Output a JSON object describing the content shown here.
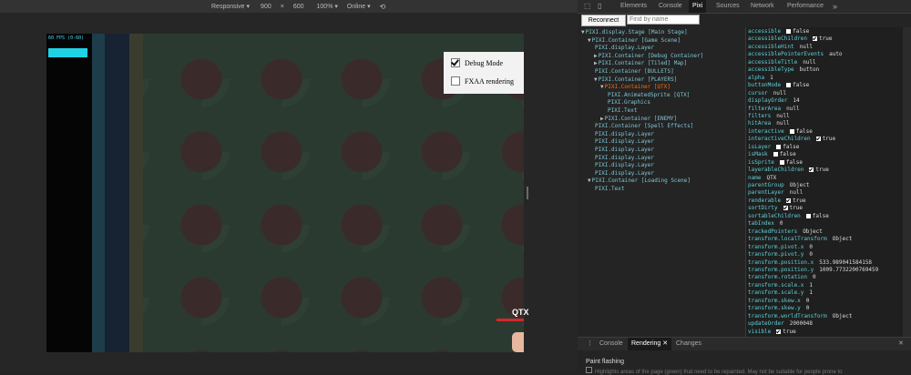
{
  "emulation": {
    "device": "Responsive ▾",
    "width": "900",
    "times": "×",
    "height": "600",
    "zoom": "100% ▾",
    "network": "Online ▾"
  },
  "game": {
    "fps_label": "60 FPS (0-60)",
    "options": [
      {
        "label": "Debug Mode",
        "checked": true
      },
      {
        "label": "FXAA rendering",
        "checked": false
      }
    ],
    "player_label": "QTX"
  },
  "devtools": {
    "tabs": [
      "Elements",
      "Console",
      "Pixi",
      "Sources",
      "Network",
      "Performance"
    ],
    "active_tab": "Pixi",
    "more": "»",
    "close": "✕"
  },
  "pixi": {
    "reconnect_label": "Reconnect",
    "find_placeholder": "Find by name",
    "tree": [
      {
        "label": "PIXI.display.Stage [Main Stage]",
        "indent": 0,
        "twisty": "▼"
      },
      {
        "label": "PIXI.Container [Game Scene]",
        "indent": 1,
        "twisty": "▼"
      },
      {
        "label": "PIXI.display.Layer",
        "indent": 2,
        "twisty": ""
      },
      {
        "label": "PIXI.Container [Debug Container]",
        "indent": 2,
        "twisty": "▶"
      },
      {
        "label": "PIXI.Container [Tiled] Map]",
        "indent": 2,
        "twisty": "▶"
      },
      {
        "label": "PIXI.Container [BULLETS]",
        "indent": 2,
        "twisty": ""
      },
      {
        "label": "PIXI.Container [PLAYERS]",
        "indent": 2,
        "twisty": "▼"
      },
      {
        "label": "PIXI.Container [QTX]",
        "indent": 3,
        "twisty": "▼",
        "selected": true
      },
      {
        "label": "PIXI.AnimatedSprite [QTX]",
        "indent": 4,
        "twisty": ""
      },
      {
        "label": "PIXI.Graphics",
        "indent": 4,
        "twisty": ""
      },
      {
        "label": "PIXI.Text",
        "indent": 4,
        "twisty": ""
      },
      {
        "label": "PIXI.Container [ENEMY]",
        "indent": 3,
        "twisty": "▶"
      },
      {
        "label": "PIXI.Container [Spell Effects]",
        "indent": 2,
        "twisty": ""
      },
      {
        "label": "PIXI.display.Layer",
        "indent": 2,
        "twisty": ""
      },
      {
        "label": "PIXI.display.Layer",
        "indent": 2,
        "twisty": ""
      },
      {
        "label": "PIXI.display.Layer",
        "indent": 2,
        "twisty": ""
      },
      {
        "label": "PIXI.display.Layer",
        "indent": 2,
        "twisty": ""
      },
      {
        "label": "PIXI.display.Layer",
        "indent": 2,
        "twisty": ""
      },
      {
        "label": "PIXI.display.Layer",
        "indent": 2,
        "twisty": ""
      },
      {
        "label": "PIXI.Container [Loading Scene]",
        "indent": 1,
        "twisty": "▼"
      },
      {
        "label": "PIXI.Text",
        "indent": 2,
        "twisty": ""
      }
    ],
    "properties": [
      {
        "key": "accessible",
        "checkbox": true,
        "checked": false,
        "value": "false"
      },
      {
        "key": "accessibleChildren",
        "checkbox": true,
        "checked": true,
        "value": "true"
      },
      {
        "key": "accessibleHint",
        "value": "null"
      },
      {
        "key": "accessiblePointerEvents",
        "value": "auto"
      },
      {
        "key": "accessibleTitle",
        "value": "null"
      },
      {
        "key": "accessibleType",
        "value": "button"
      },
      {
        "key": "alpha",
        "value": "1"
      },
      {
        "key": "buttonMode",
        "checkbox": true,
        "checked": false,
        "value": "false"
      },
      {
        "key": "cursor",
        "value": "null"
      },
      {
        "key": "displayOrder",
        "value": "14"
      },
      {
        "key": "filterArea",
        "value": "null"
      },
      {
        "key": "filters",
        "value": "null"
      },
      {
        "key": "hitArea",
        "value": "null"
      },
      {
        "key": "interactive",
        "checkbox": true,
        "checked": false,
        "value": "false"
      },
      {
        "key": "interactiveChildren",
        "checkbox": true,
        "checked": true,
        "value": "true"
      },
      {
        "key": "isLayer",
        "checkbox": true,
        "checked": false,
        "value": "false"
      },
      {
        "key": "isMask",
        "checkbox": true,
        "checked": false,
        "value": "false"
      },
      {
        "key": "isSprite",
        "checkbox": true,
        "checked": false,
        "value": "false"
      },
      {
        "key": "layerableChildren",
        "checkbox": true,
        "checked": true,
        "value": "true"
      },
      {
        "key": "name",
        "value": "QTX"
      },
      {
        "key": "parentGroup",
        "value": "Object"
      },
      {
        "key": "parentLayer",
        "value": "null"
      },
      {
        "key": "renderable",
        "checkbox": true,
        "checked": true,
        "value": "true"
      },
      {
        "key": "sortDirty",
        "checkbox": true,
        "checked": true,
        "value": "true"
      },
      {
        "key": "sortableChildren",
        "checkbox": true,
        "checked": false,
        "value": "false"
      },
      {
        "key": "tabIndex",
        "value": "0"
      },
      {
        "key": "trackedPointers",
        "value": "Object"
      },
      {
        "key": "transform.localTransform",
        "value": "Object"
      },
      {
        "key": "transform.pivot.x",
        "value": "0"
      },
      {
        "key": "transform.pivot.y",
        "value": "0"
      },
      {
        "key": "transform.position.x",
        "value": "533.989041584158"
      },
      {
        "key": "transform.position.y",
        "value": "1009.7732200769459"
      },
      {
        "key": "transform.rotation",
        "value": "0"
      },
      {
        "key": "transform.scale.x",
        "value": "1"
      },
      {
        "key": "transform.scale.y",
        "value": "1"
      },
      {
        "key": "transform.skew.x",
        "value": "0"
      },
      {
        "key": "transform.skew.y",
        "value": "0"
      },
      {
        "key": "transform.worldTransform",
        "value": "Object"
      },
      {
        "key": "updateOrder",
        "value": "2000048"
      },
      {
        "key": "visible",
        "checkbox": true,
        "checked": true,
        "value": "true"
      }
    ]
  },
  "drawer": {
    "tabs": [
      "Console",
      "Rendering",
      "Changes"
    ],
    "active_tab": "Rendering",
    "tab_close": "✕",
    "close": "✕",
    "section_title": "Paint flashing",
    "section_desc": "Highlights areas of the page (green) that need to be repainted. May not be suitable for people prone to"
  }
}
